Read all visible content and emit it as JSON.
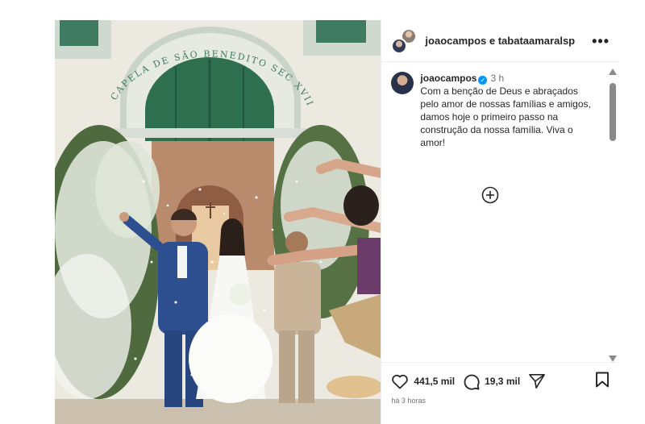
{
  "post": {
    "header": {
      "usernames": "joaocampos e tabataamaralsp",
      "more_icon": "more-horizontal-icon"
    },
    "photo": {
      "chapel_sign": "CAPELA DE SÃO BENEDITO SEC XVIII"
    },
    "caption": {
      "username": "joaocampos",
      "verified_icon": "✓",
      "time": "3 h",
      "text": "Com a benção de Deus e abraçados pelo amor de nossas famílias e amigos, damos hoje o primeiro passo na construção da nossa família. Viva o amor!"
    },
    "actions": {
      "likes": "441,5 mil",
      "comments": "19,3 mil",
      "posted_ago": "há 3 horas"
    },
    "colors": {
      "verified": "#0095f6",
      "text": "#262626",
      "muted": "#737373"
    }
  }
}
